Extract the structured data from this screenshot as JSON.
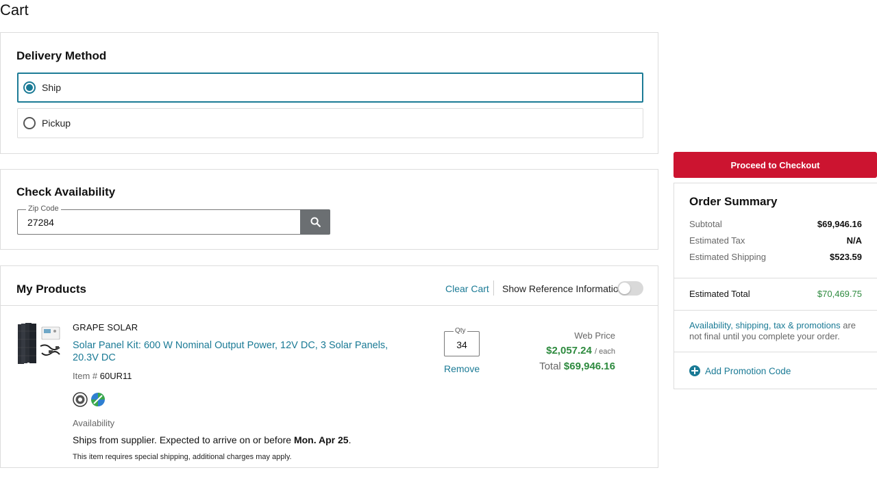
{
  "page": {
    "title": "Cart"
  },
  "delivery": {
    "title": "Delivery Method",
    "options": [
      {
        "label": "Ship",
        "selected": true
      },
      {
        "label": "Pickup",
        "selected": false
      }
    ]
  },
  "availability": {
    "title": "Check Availability",
    "zip_label": "Zip Code",
    "zip_value": "27284",
    "search_icon": "search-icon"
  },
  "products": {
    "title": "My Products",
    "clear_cart": "Clear Cart",
    "reference_label": "Show Reference Information",
    "reference_toggle_on": false,
    "items": [
      {
        "brand": "GRAPE SOLAR",
        "name": "Solar Panel Kit: 600 W Nominal Output Power, 12V DC, 3 Solar Panels, 20.3V DC",
        "item_label": "Item #",
        "item_number": "60UR11",
        "availability_label": "Availability",
        "ship_text": "Ships from supplier. Expected to arrive on or before ",
        "ship_date": "Mon. Apr 25",
        "ship_suffix": ".",
        "special_note": "This item requires special shipping, additional charges may apply.",
        "qty_label": "Qty",
        "qty": "34",
        "remove_label": "Remove",
        "web_price_label": "Web Price",
        "unit_price": "$2,057.24",
        "unit_suffix": "/ each",
        "total_label": "Total",
        "total": "$69,946.16"
      }
    ]
  },
  "checkout": {
    "button": "Proceed to Checkout"
  },
  "summary": {
    "title": "Order Summary",
    "rows": [
      {
        "label": "Subtotal",
        "value": "$69,946.16"
      },
      {
        "label": "Estimated Tax",
        "value": "N/A"
      },
      {
        "label": "Estimated Shipping",
        "value": "$523.59"
      }
    ],
    "total_label": "Estimated Total",
    "total_value": "$70,469.75",
    "disclaimer_link": "Availability, shipping, tax & promotions",
    "disclaimer_text": " are not final until you complete your order.",
    "promo_label": "Add Promotion Code"
  },
  "colors": {
    "accent": "#1a7a95",
    "checkout": "#cc1430",
    "price_green": "#2d8a3e"
  }
}
